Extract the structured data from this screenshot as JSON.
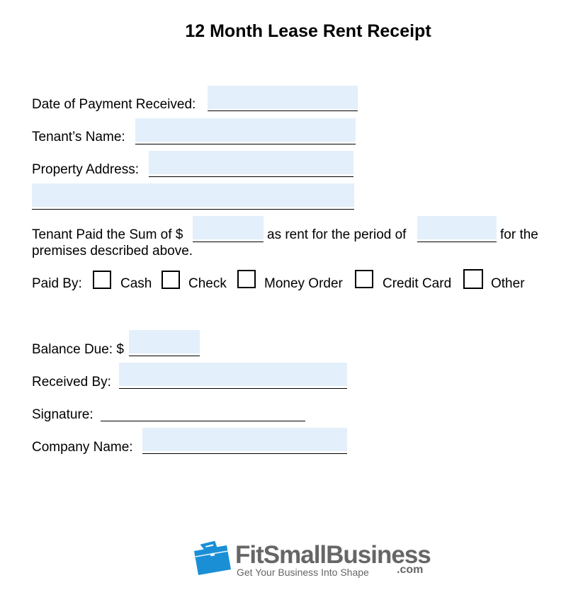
{
  "title": "12 Month Lease Rent Receipt",
  "fields": {
    "date_label": "Date of Payment Received:",
    "tenant_label": "Tenant’s Name:",
    "address_label": "Property Address:",
    "paid_sum_prefix": "Tenant Paid the Sum of $",
    "paid_sum_middle": "as rent for the period of",
    "paid_sum_suffix": "for the",
    "paid_sum_line2": "premises described above.",
    "paid_by_label": "Paid By:",
    "balance_label": "Balance Due: $",
    "received_label": "Received By:",
    "signature_label": "Signature:",
    "company_label": "Company Name:"
  },
  "values": {
    "date": "",
    "tenant": "",
    "address1": "",
    "address2": "",
    "sum": "",
    "period": "",
    "balance": "",
    "received_by": "",
    "company": ""
  },
  "payment_options": [
    {
      "label": "Cash",
      "checked": false
    },
    {
      "label": "Check",
      "checked": false
    },
    {
      "label": "Money Order",
      "checked": false
    },
    {
      "label": "Credit Card",
      "checked": false
    },
    {
      "label": "Other",
      "checked": false
    }
  ],
  "logo": {
    "icon": "briefcase-icon",
    "name": "FitSmallBusiness",
    "tagline": "Get Your Business Into Shape",
    "domain": ".com",
    "brand_color": "#1a8fd6"
  }
}
